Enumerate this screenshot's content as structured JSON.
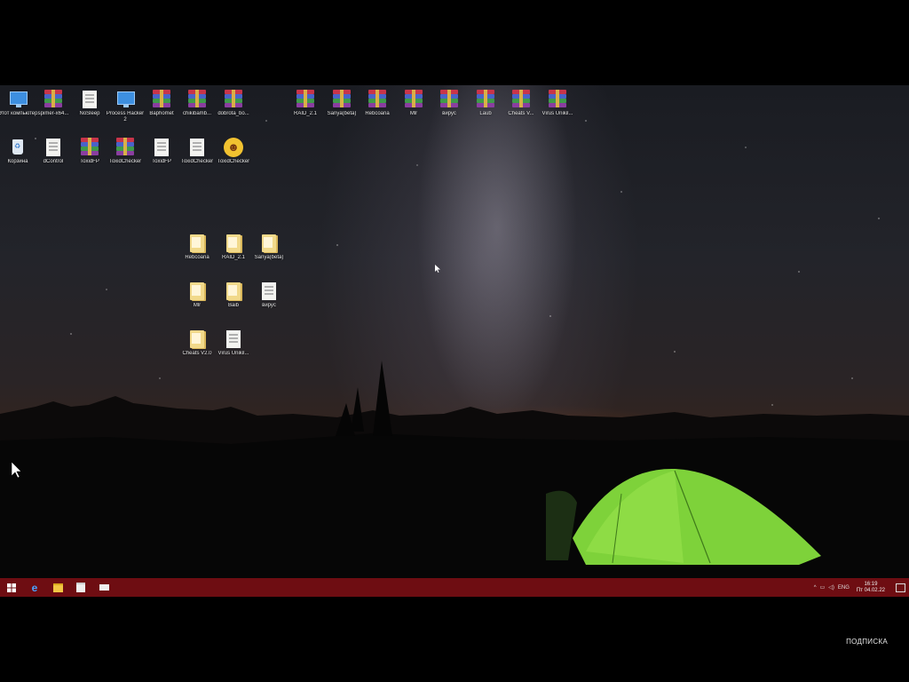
{
  "desktop_icons_top": [
    {
      "label": "Этот компьютер",
      "icon": "computer-icon"
    },
    {
      "label": "spimer-x64...",
      "icon": "winrar-icon"
    },
    {
      "label": "NoSleep",
      "icon": "document-icon"
    },
    {
      "label": "Process Hacker 2",
      "icon": "computer-icon"
    },
    {
      "label": "Baphomet",
      "icon": "winrar-icon"
    },
    {
      "label": "chikibamb...",
      "icon": "winrar-icon"
    },
    {
      "label": "dobrota_bo...",
      "icon": "winrar-icon"
    },
    {
      "label": "RAID_2.1",
      "icon": "winrar-icon"
    },
    {
      "label": "Sanya(beta)",
      "icon": "winrar-icon"
    },
    {
      "label": "Rebcoana",
      "icon": "winrar-icon"
    },
    {
      "label": "Mlr",
      "icon": "winrar-icon"
    },
    {
      "label": "вирус",
      "icon": "winrar-icon"
    },
    {
      "label": "Laub",
      "icon": "winrar-icon"
    },
    {
      "label": "Cheats V...",
      "icon": "winrar-icon"
    },
    {
      "label": "Virus Unikil...",
      "icon": "winrar-icon"
    }
  ],
  "desktop_icons_row2": [
    {
      "label": "Корзина",
      "icon": "recycle-bin-icon"
    },
    {
      "label": "dControl",
      "icon": "document-icon"
    },
    {
      "label": "ToxidFP",
      "icon": "winrar-icon"
    },
    {
      "label": "ToxidChecker",
      "icon": "winrar-icon"
    },
    {
      "label": "ToxidFP",
      "icon": "document-icon"
    },
    {
      "label": "ToxidChecker",
      "icon": "document-icon"
    },
    {
      "label": "ToxidChecker",
      "icon": "smiley-icon"
    }
  ],
  "folder_icons": [
    {
      "label": "Rebcoana",
      "icon": "folder-icon"
    },
    {
      "label": "RAID_2.1",
      "icon": "folder-icon"
    },
    {
      "label": "Sanya(beta)",
      "icon": "folder-icon"
    },
    {
      "label": "Mlr",
      "icon": "folder-icon"
    },
    {
      "label": "Baib",
      "icon": "folder-icon"
    },
    {
      "label": "вирус",
      "icon": "document-icon"
    },
    {
      "label": "Cheats V2.0",
      "icon": "folder-icon"
    },
    {
      "label": "Virus Unikil...",
      "icon": "document-icon"
    }
  ],
  "taskbar": {
    "language": "ENG",
    "time": "16:19",
    "date": "Пт 04.02.22"
  },
  "caption": "ПОДПИСКА",
  "colors": {
    "taskbar": "#6e0d12",
    "tent": "#7ed23a"
  }
}
